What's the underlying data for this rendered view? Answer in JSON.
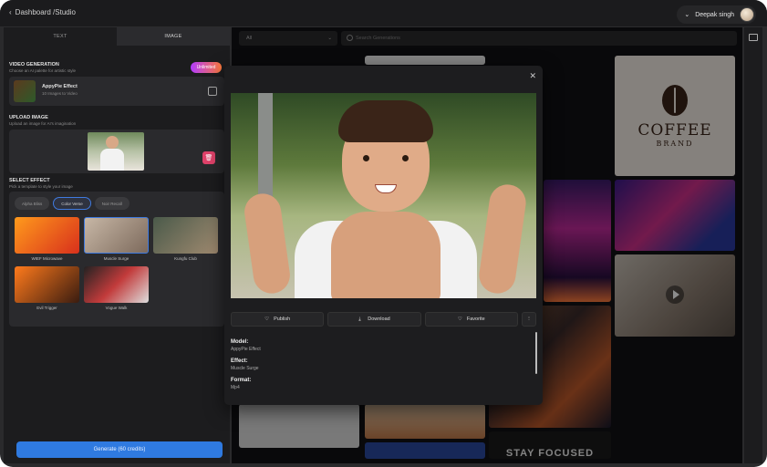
{
  "topbar": {
    "back_label": "Dashboard /Studio",
    "user_name": "Deepak singh"
  },
  "left": {
    "tabs": [
      {
        "label": "TEXT"
      },
      {
        "label": "IMAGE"
      }
    ],
    "video_generation": {
      "title": "VIDEO GENERATION",
      "subtitle": "Choose an AI palette for artistic style",
      "badge": "Unlimited"
    },
    "effect": {
      "name": "AppyPie Effect",
      "meta": "10 Images to Video"
    },
    "upload": {
      "title": "UPLOAD IMAGE",
      "subtitle": "Upload an image for AI's imagination"
    },
    "select_effect": {
      "title": "SELECT EFFECT",
      "subtitle": "Pick a template to style your image",
      "chips": [
        {
          "label": "Alpha Bliss"
        },
        {
          "label": "Color Verse"
        },
        {
          "label": "Noir Recall"
        }
      ],
      "effects": [
        {
          "label": "WIEF Microwave"
        },
        {
          "label": "Muscle Surge"
        },
        {
          "label": "Kungfu Club"
        },
        {
          "label": "Evil Trigger"
        },
        {
          "label": "Vogue Walk"
        }
      ]
    },
    "generate_label": "Generate (60 credits)"
  },
  "main": {
    "filter_value": "All",
    "search_placeholder": "Search Generations",
    "coffee": {
      "line1": "COFFEE",
      "line2": "BRAND"
    },
    "stay_text": "STAY FOCUSED"
  },
  "modal": {
    "actions": [
      {
        "label": "Publish"
      },
      {
        "label": "Download"
      },
      {
        "label": "Favorite"
      }
    ],
    "meta": [
      {
        "key": "Model:",
        "value": "AppyPie Effect"
      },
      {
        "key": "Effect:",
        "value": "Muscle Surge"
      },
      {
        "key": "Format:",
        "value": "Mp4"
      }
    ]
  },
  "colors": {
    "accent": "#2f7ae0",
    "badge_start": "#b23cff",
    "badge_end": "#ff7a3c",
    "delete": "#e0426a"
  },
  "icons": [
    "chevron-left-icon",
    "chevron-down-icon",
    "search-icon",
    "swap-icon",
    "trash-icon",
    "close-icon",
    "heart-icon",
    "download-icon",
    "more-icon",
    "play-icon",
    "panel-icon"
  ]
}
